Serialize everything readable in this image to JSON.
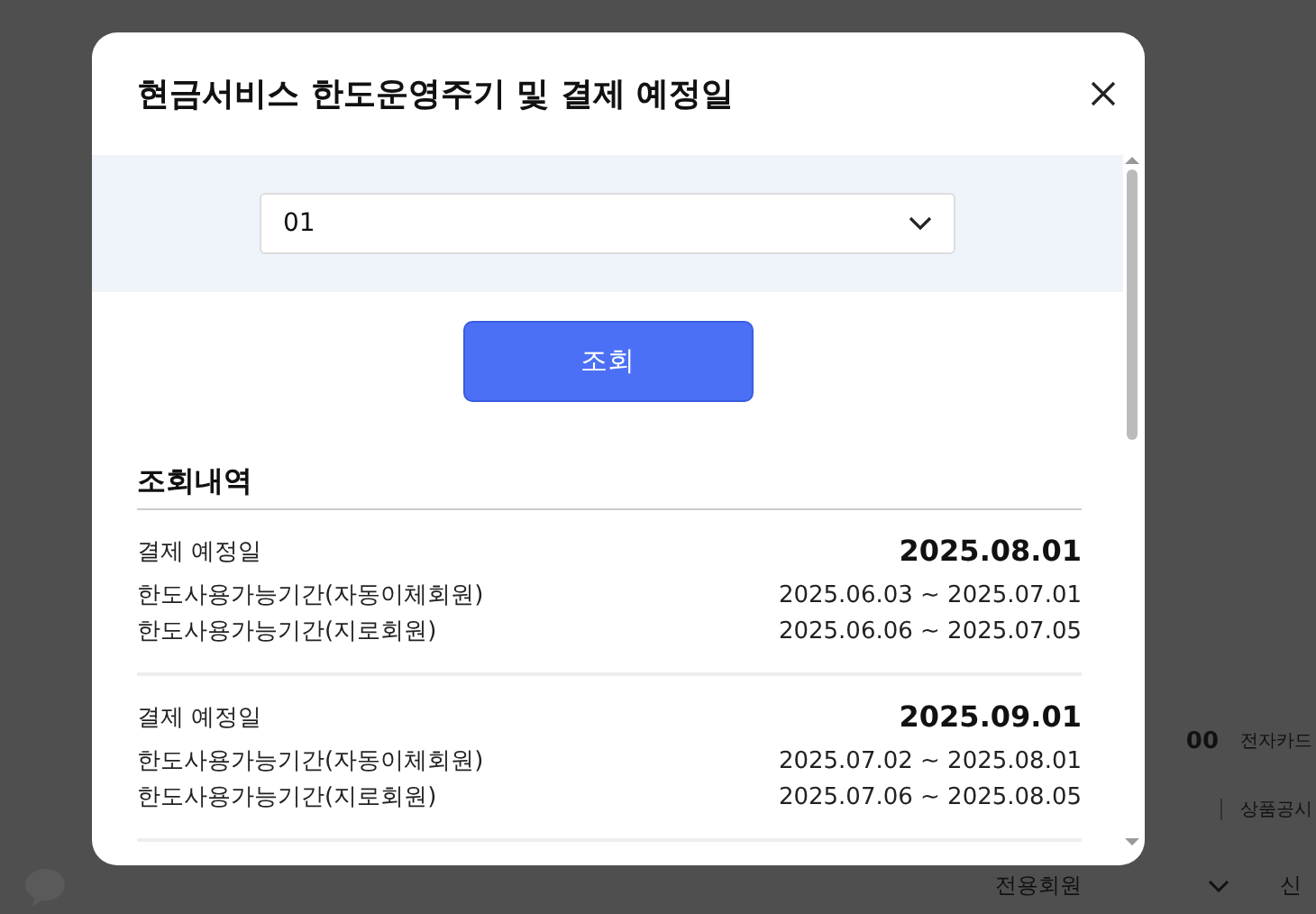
{
  "background_page": {
    "info_row": {
      "right_1": "00",
      "right_2": "전자카드"
    },
    "links_row": {
      "right": "상품공시"
    },
    "footer": {
      "select": "전용회원",
      "right": "신"
    }
  },
  "modal": {
    "title": "현금서비스 한도운영주기 및 결제 예정일",
    "select_value": "01",
    "search_button": "조회",
    "section_title": "조회내역",
    "results": [
      {
        "date_label": "결제 예정일",
        "date": "2025.08.01",
        "periods": [
          {
            "label": "한도사용가능기간(자동이체회원)",
            "range": "2025.06.03 ~ 2025.07.01"
          },
          {
            "label": "한도사용가능기간(지로회원)",
            "range": "2025.06.06 ~ 2025.07.05"
          }
        ]
      },
      {
        "date_label": "결제 예정일",
        "date": "2025.09.01",
        "periods": [
          {
            "label": "한도사용가능기간(자동이체회원)",
            "range": "2025.07.02 ~ 2025.08.01"
          },
          {
            "label": "한도사용가능기간(지로회원)",
            "range": "2025.07.06 ~ 2025.08.05"
          }
        ]
      }
    ]
  }
}
